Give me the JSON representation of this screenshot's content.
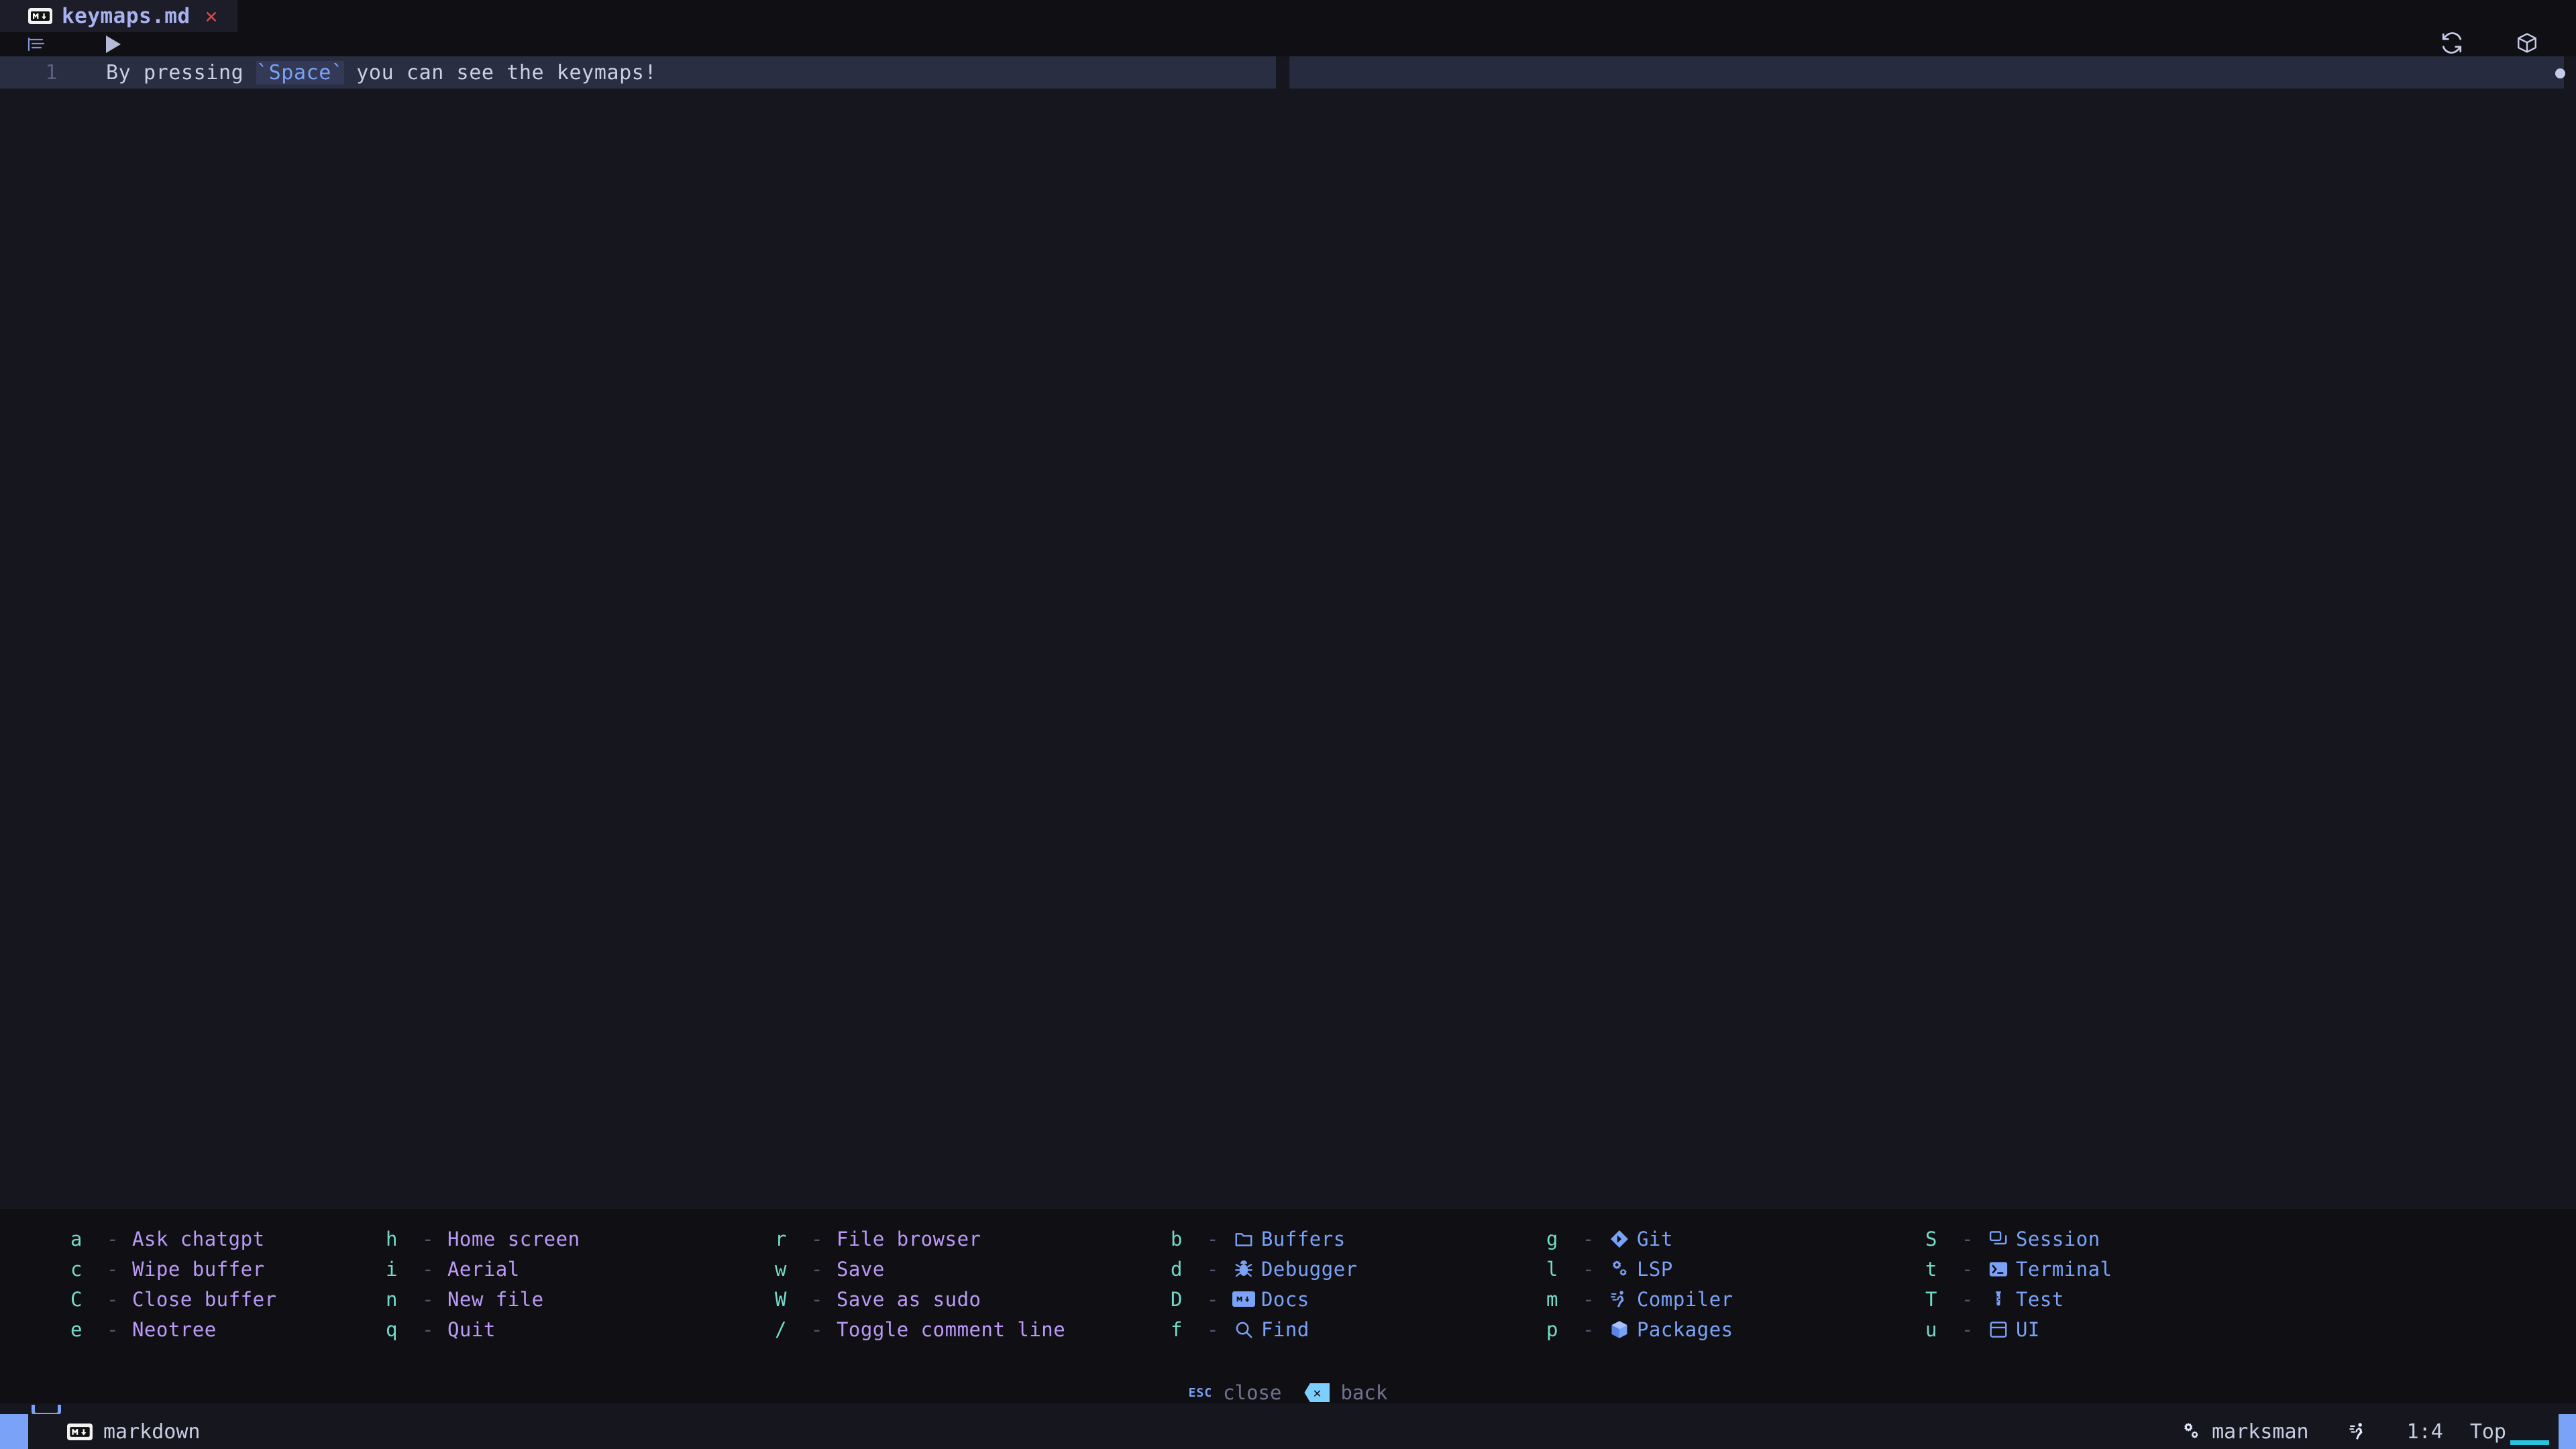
{
  "tabbar": {
    "tabs": [
      {
        "icon": "markdown-badge",
        "title": "keymaps.md",
        "close": "✕",
        "active": true
      }
    ]
  },
  "winbar": {
    "gutter_icon": "outline-icon",
    "marker_icon": "play-triangle-icon",
    "right_icons": [
      "refresh-icon",
      "package-cube-icon"
    ]
  },
  "editor": {
    "line_number": "1",
    "line_prefix": "By pressing ",
    "code_span": "`Space`",
    "line_suffix": " you can see the keymaps!",
    "full_line": "By pressing `Space` you can see the keymaps!"
  },
  "keymaps": {
    "columns": [
      {
        "items": [
          {
            "key": "a",
            "dash": "-",
            "label": "Ask chatgpt",
            "icon": ""
          },
          {
            "key": "c",
            "dash": "-",
            "label": "Wipe buffer",
            "icon": ""
          },
          {
            "key": "C",
            "dash": "-",
            "label": "Close buffer",
            "icon": ""
          },
          {
            "key": "e",
            "dash": "-",
            "label": "Neotree",
            "icon": ""
          }
        ]
      },
      {
        "items": [
          {
            "key": "h",
            "dash": "-",
            "label": "Home screen",
            "icon": ""
          },
          {
            "key": "i",
            "dash": "-",
            "label": "Aerial",
            "icon": ""
          },
          {
            "key": "n",
            "dash": "-",
            "label": "New file",
            "icon": ""
          },
          {
            "key": "q",
            "dash": "-",
            "label": "Quit",
            "icon": ""
          }
        ]
      },
      {
        "items": [
          {
            "key": "r",
            "dash": "-",
            "label": "File browser",
            "icon": ""
          },
          {
            "key": "w",
            "dash": "-",
            "label": "Save",
            "icon": ""
          },
          {
            "key": "W",
            "dash": "-",
            "label": "Save as sudo",
            "icon": ""
          },
          {
            "key": "/",
            "dash": "-",
            "label": "Toggle comment line",
            "icon": ""
          }
        ]
      },
      {
        "group": true,
        "items": [
          {
            "key": "b",
            "dash": "-",
            "label": "Buffers",
            "icon": "folder-icon"
          },
          {
            "key": "d",
            "dash": "-",
            "label": "Debugger",
            "icon": "bug-icon"
          },
          {
            "key": "D",
            "dash": "-",
            "label": "Docs",
            "icon": "markdown-badge"
          },
          {
            "key": "f",
            "dash": "-",
            "label": "Find",
            "icon": "search-icon"
          }
        ]
      },
      {
        "group": true,
        "items": [
          {
            "key": "g",
            "dash": "-",
            "label": "Git",
            "icon": "git-diamond-icon"
          },
          {
            "key": "l",
            "dash": "-",
            "label": "LSP",
            "icon": "gears-icon"
          },
          {
            "key": "m",
            "dash": "-",
            "label": "Compiler",
            "icon": "runner-icon"
          },
          {
            "key": "p",
            "dash": "-",
            "label": "Packages",
            "icon": "cube-icon"
          }
        ]
      },
      {
        "group": true,
        "items": [
          {
            "key": "S",
            "dash": "-",
            "label": "Session",
            "icon": "windows-icon"
          },
          {
            "key": "t",
            "dash": "-",
            "label": "Terminal",
            "icon": "terminal-icon"
          },
          {
            "key": "T",
            "dash": "-",
            "label": "Test",
            "icon": "test-tube-icon"
          },
          {
            "key": "u",
            "dash": "-",
            "label": "UI",
            "icon": "layout-icon"
          }
        ]
      }
    ],
    "hints": [
      {
        "key": "ESC",
        "label": "close",
        "icon": ""
      },
      {
        "key": "✕",
        "label": "back",
        "icon": "backspace-key-icon"
      }
    ]
  },
  "statusline": {
    "filetype_icon": "markdown-badge",
    "filetype": "markdown",
    "lsp_icon": "gears-icon",
    "lsp": "marksman",
    "runner_icon": "runner-icon",
    "position": "1:4",
    "scroll": "Top"
  }
}
